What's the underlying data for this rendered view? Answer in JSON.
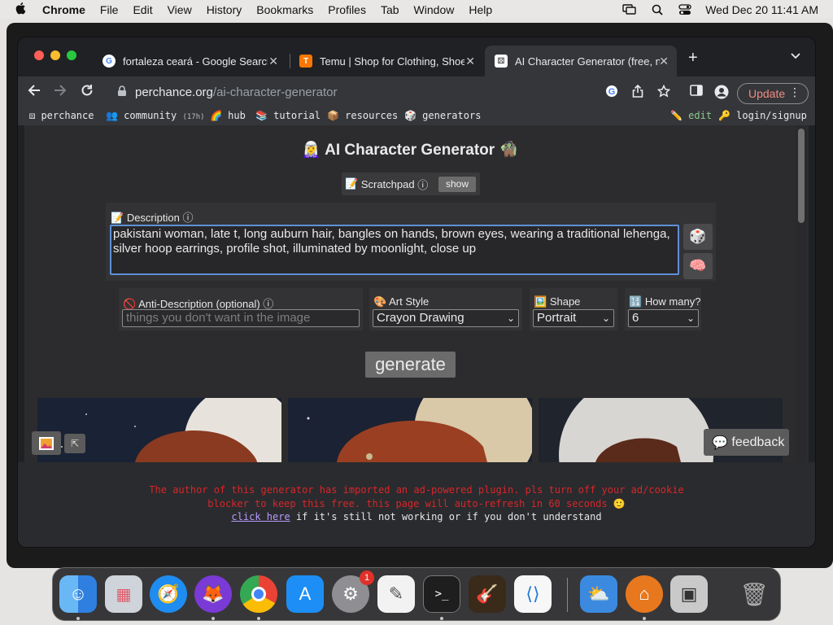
{
  "menubar": {
    "app": "Chrome",
    "items": [
      "File",
      "Edit",
      "View",
      "History",
      "Bookmarks",
      "Profiles",
      "Tab",
      "Window",
      "Help"
    ],
    "datetime": "Wed Dec 20  11:41 AM"
  },
  "tabs": [
    {
      "title": "fortaleza ceará - Google Search",
      "favicon": "G",
      "favicon_color": "#ffffff"
    },
    {
      "title": "Temu | Shop for Clothing, Shoes",
      "favicon": "T",
      "favicon_color": "#fb7701"
    },
    {
      "title": "AI Character Generator (free, no",
      "favicon": "⚄",
      "favicon_color": "#ffffff"
    }
  ],
  "address": {
    "domain": "perchance.org",
    "path": "/ai-character-generator"
  },
  "update_label": "Update",
  "bookmarks": {
    "perchance": "perchance",
    "community": "community",
    "community_badge": "(17h)",
    "hub": "hub",
    "tutorial": "tutorial",
    "resources": "resources",
    "generators": "generators",
    "edit": "edit",
    "login": "login/signup"
  },
  "page": {
    "title": "AI Character Generator",
    "scratchpad_label": "Scratchpad",
    "scratchpad_show": "show",
    "description_label": "Description",
    "description_value": "pakistani woman, late t, long auburn hair, bangles on hands, brown eyes, wearing a traditional lehenga, silver hoop earrings, profile shot, illuminated by moonlight, close up",
    "anti_label": "Anti-Description (optional)",
    "anti_placeholder": "things you don't want in the image",
    "art_style_label": "Art Style",
    "art_style_value": "Crayon Drawing",
    "shape_label": "Shape",
    "shape_value": "Portrait",
    "how_many_label": "How many?",
    "how_many_value": "6",
    "generate_label": "generate",
    "feedback_label": "feedback"
  },
  "footer": {
    "line1": "The author of this generator has imported an ad-powered plugin. pls turn off your ad/cookie",
    "line2": "blocker to keep this free. this page will auto-refresh in 60 seconds 🙂",
    "link": "click here",
    "line3_rest": " if it's still not working or if you don't understand"
  },
  "dock": [
    "finder-icon",
    "launchpad-icon",
    "safari-icon",
    "firefox-icon",
    "chrome-icon",
    "app-store-icon",
    "system-settings-icon",
    "textedit-icon",
    "terminal-icon",
    "garageband-icon",
    "vscode-icon",
    "weather-icon",
    "instruments-icon",
    "preview-icon",
    "trash-icon"
  ],
  "dock_badge": "1",
  "colors": {
    "accent_focus": "#5f8fd8",
    "warning_red": "#d8262a",
    "update_text": "#f28b82"
  }
}
